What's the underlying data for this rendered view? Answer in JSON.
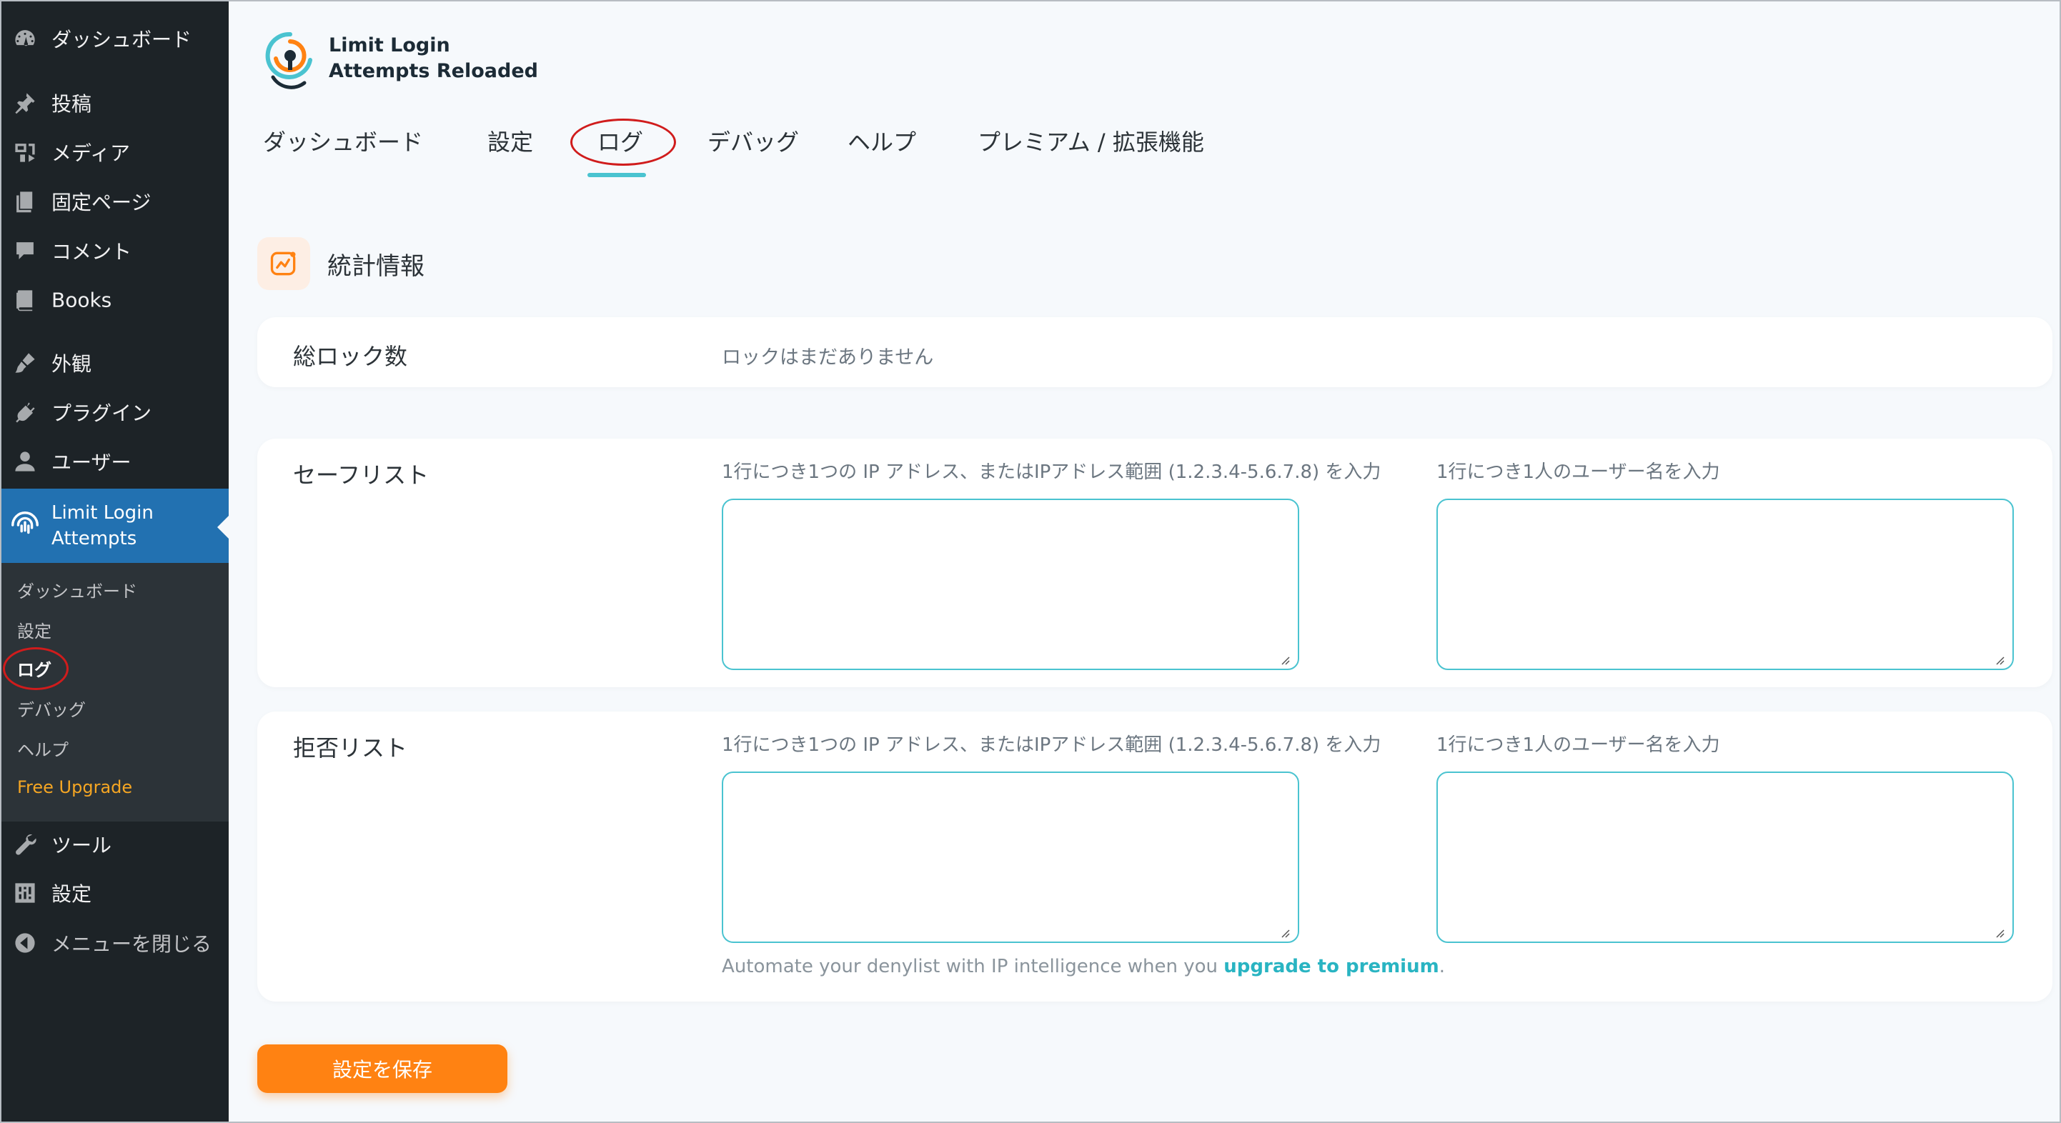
{
  "sidebar": {
    "items": [
      {
        "label": "ダッシュボード",
        "icon": "dashboard-icon"
      },
      {
        "label": "投稿",
        "icon": "pin-icon"
      },
      {
        "label": "メディア",
        "icon": "media-icon"
      },
      {
        "label": "固定ページ",
        "icon": "page-icon"
      },
      {
        "label": "コメント",
        "icon": "comment-icon"
      },
      {
        "label": "Books",
        "icon": "book-icon"
      },
      {
        "label": "外観",
        "icon": "brush-icon"
      },
      {
        "label": "プラグイン",
        "icon": "plugin-icon"
      },
      {
        "label": "ユーザー",
        "icon": "user-icon"
      }
    ],
    "active": {
      "line1": "Limit Login",
      "line2": "Attempts",
      "icon": "fingerprint-icon"
    },
    "submenu": [
      {
        "label": "ダッシュボード"
      },
      {
        "label": "設定"
      },
      {
        "label": "ログ"
      },
      {
        "label": "デバッグ"
      },
      {
        "label": "ヘルプ"
      },
      {
        "label": "Free Upgrade"
      }
    ],
    "bottom": [
      {
        "label": "ツール",
        "icon": "wrench-icon"
      },
      {
        "label": "設定",
        "icon": "settings-icon"
      },
      {
        "label": "メニューを閉じる",
        "icon": "collapse-icon"
      }
    ]
  },
  "brand": {
    "line1": "Limit Login",
    "line2": "Attempts Reloaded"
  },
  "tabs": [
    {
      "label": "ダッシュボード"
    },
    {
      "label": "設定"
    },
    {
      "label": "ログ"
    },
    {
      "label": "デバッグ"
    },
    {
      "label": "ヘルプ"
    },
    {
      "label": "プレミアム / 拡張機能"
    }
  ],
  "stats": {
    "title": "統計情報",
    "total_label": "総ロック数",
    "total_value": "ロックはまだありません"
  },
  "safelist": {
    "title": "セーフリスト",
    "ip_label": "1行につき1つの IP アドレス、またはIPアドレス範囲 (1.2.3.4-5.6.7.8) を入力",
    "user_label": "1行につき1人のユーザー名を入力",
    "ip_value": "",
    "user_value": ""
  },
  "denylist": {
    "title": "拒否リスト",
    "ip_label": "1行につき1つの IP アドレス、またはIPアドレス範囲 (1.2.3.4-5.6.7.8) を入力",
    "user_label": "1行につき1人のユーザー名を入力",
    "ip_value": "",
    "user_value": "",
    "promo_text": "Automate your denylist with IP intelligence when you ",
    "promo_link": "upgrade to premium",
    "promo_end": "."
  },
  "save_label": "設定を保存",
  "colors": {
    "sidebar_bg": "#1d2327",
    "active_bg": "#2271b1",
    "accent_teal": "#4ac3d0",
    "save_orange": "#ff8212",
    "upgrade_orange": "#f5a623",
    "annotation_red": "#d01c1c"
  }
}
